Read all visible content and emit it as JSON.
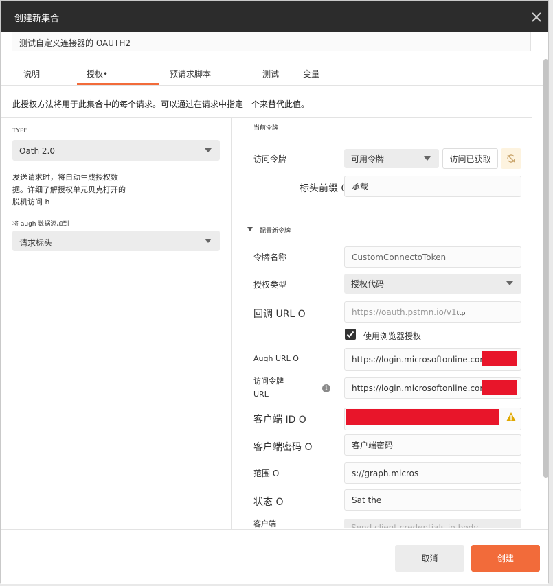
{
  "dialog": {
    "title": "创建新集合",
    "name_value": "测试自定义连接器的 OAUTH2"
  },
  "tabs": [
    {
      "label": "说明"
    },
    {
      "label": "授权•"
    },
    {
      "label": "预请求脚本"
    },
    {
      "label": "测试"
    },
    {
      "label": "变量"
    }
  ],
  "auth": {
    "description": "此授权方法将用于此集合中的每个请求。可以通过在请求中指定一个来替代此值。",
    "type_label": "TYPE",
    "type_value": "Oath 2.0",
    "help_line1": "发送请求时，将自动生成授权数",
    "help_line2": "据。详细了解授权单元贝克打开的",
    "help_line3": "脱机访问 h",
    "add_to_label": "将 augh 数据添加到",
    "add_to_value": "请求标头"
  },
  "current_token": {
    "section": "当前令牌",
    "access_token_label": "访问令牌",
    "available_tokens": "可用令牌",
    "access_button": "访问已获取",
    "header_prefix_label": "标头前缀 O",
    "header_prefix_value": "承载"
  },
  "new_token": {
    "section": "配置新令牌",
    "token_name_label": "令牌名称",
    "token_name_value": "CustomConnectoToken",
    "grant_type_label": "授权类型",
    "grant_type_value": "授权代码",
    "callback_label": "回调 URL O",
    "callback_value": "https://oauth.pstmn.io/v1",
    "callback_suffix": "ttp",
    "browser_label": "使用浏览器授权",
    "auth_url_label": "Augh URL O",
    "auth_url_value": "https://login.microsoftonline.com/",
    "token_url_label1": "访问令牌",
    "token_url_label2": "URL",
    "token_url_value": "https://login.microsoftonline.com/",
    "client_id_label": "客户端 ID O",
    "client_secret_label": "客户端密码 O",
    "client_secret_value": "客户端密码",
    "scope_label": "范围 O",
    "scope_value": "s://graph.micros",
    "state_label": "状态 O",
    "state_value": "Sat the",
    "client_auth_label": "客户端",
    "client_auth_value": "Send client credentials in body"
  },
  "footer": {
    "cancel": "取消",
    "create": "创建"
  },
  "colors": {
    "accent": "#f26b3a",
    "titlebar": "#2c2c2c",
    "redaction": "#e8152a",
    "warning": "#e0a800"
  }
}
